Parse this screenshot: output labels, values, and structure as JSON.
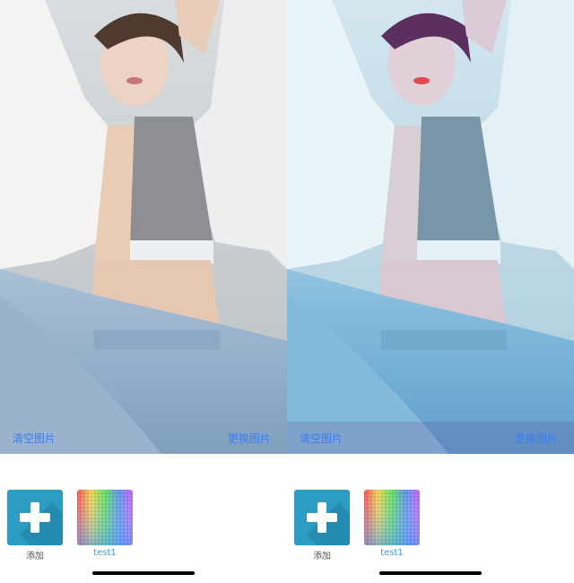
{
  "panes": [
    {
      "variant": "original",
      "clear_label": "清空图片",
      "change_label": "更换图片",
      "filters": [
        {
          "label": "添加",
          "icon": "plus-icon"
        },
        {
          "label": "test1",
          "icon": "color-grid-lut"
        }
      ]
    },
    {
      "variant": "filtered",
      "clear_label": "清空图片",
      "change_label": "更换图片",
      "filters": [
        {
          "label": "添加",
          "icon": "plus-icon"
        },
        {
          "label": "test1",
          "icon": "color-grid-lut"
        }
      ]
    }
  ],
  "colors": {
    "accent_link": "#3a7ef0",
    "add_button": "#2d9cc2",
    "filter_label": "#3a9ad8"
  }
}
